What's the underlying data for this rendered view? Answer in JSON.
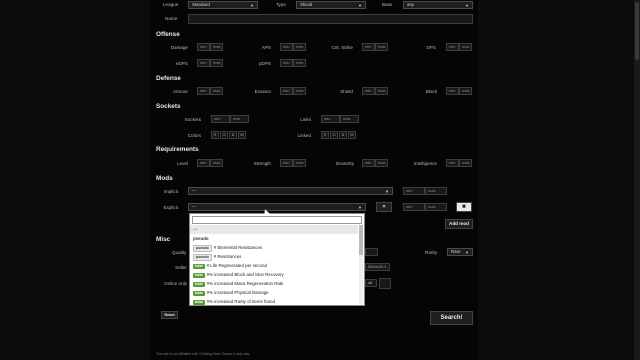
{
  "top": {
    "league_label": "League",
    "league_value": "Standard",
    "type_label": "Type",
    "type_value": "Shield",
    "base_label": "Base",
    "base_value": "any",
    "name_label": "Name"
  },
  "placeholders": {
    "min": "min",
    "max": "max"
  },
  "offense": {
    "title": "Offense",
    "damage": "Damage",
    "aps": "APS",
    "crit": "Crit. Strike",
    "dps": "DPS",
    "edps": "eDPS",
    "pdps": "pDPS"
  },
  "defense": {
    "title": "Defense",
    "armour": "Armour",
    "evasion": "Evasion",
    "shield": "Shield",
    "block": "Block"
  },
  "sockets": {
    "title": "Sockets",
    "sockets": "Sockets",
    "links": "Links",
    "colors": "Colors",
    "linked": "Linked",
    "letters": [
      "R",
      "G",
      "B",
      "W"
    ]
  },
  "requirements": {
    "title": "Requirements",
    "level": "Level",
    "strength": "Strength",
    "dexterity": "Dexterity",
    "intelligence": "Intelligence"
  },
  "mods": {
    "title": "Mods",
    "implicit": "Implicit",
    "implicit_value": "---",
    "explicit": "Explicit",
    "explicit_value": "---",
    "add_mod": "Add mod",
    "equals": "=",
    "remove": "✖"
  },
  "misc": {
    "title": "Misc",
    "quality": "Quality",
    "rarity": "Rarity",
    "rarity_value": "Rare",
    "online_only": "Online only",
    "date_value": "2014-02-1",
    "off_value": "off"
  },
  "dropdown": {
    "items": [
      {
        "text": "---",
        "kind": "plain"
      },
      {
        "text": "pseudo",
        "kind": "group"
      },
      {
        "tag": "pseudo",
        "text": "# Elemental Resistances",
        "kind": "pseudo"
      },
      {
        "tag": "pseudo",
        "text": "# Resistances",
        "kind": "pseudo"
      },
      {
        "tag": "total",
        "text": "# Life Regenerated per second",
        "kind": "total"
      },
      {
        "tag": "total",
        "text": "#% increased Block and Stun Recovery",
        "kind": "total"
      },
      {
        "tag": "total",
        "text": "#% increased Mana Regeneration Rate",
        "kind": "total"
      },
      {
        "tag": "total",
        "text": "#% increased Physical Damage",
        "kind": "total"
      },
      {
        "tag": "total",
        "text": "#% increased Rarity of Items found",
        "kind": "total"
      }
    ]
  },
  "buttons": {
    "reset": "Reset",
    "search": "Search!"
  },
  "footer": {
    "line1": "This site is not affiliated with Grinding Gear Games in any way."
  }
}
